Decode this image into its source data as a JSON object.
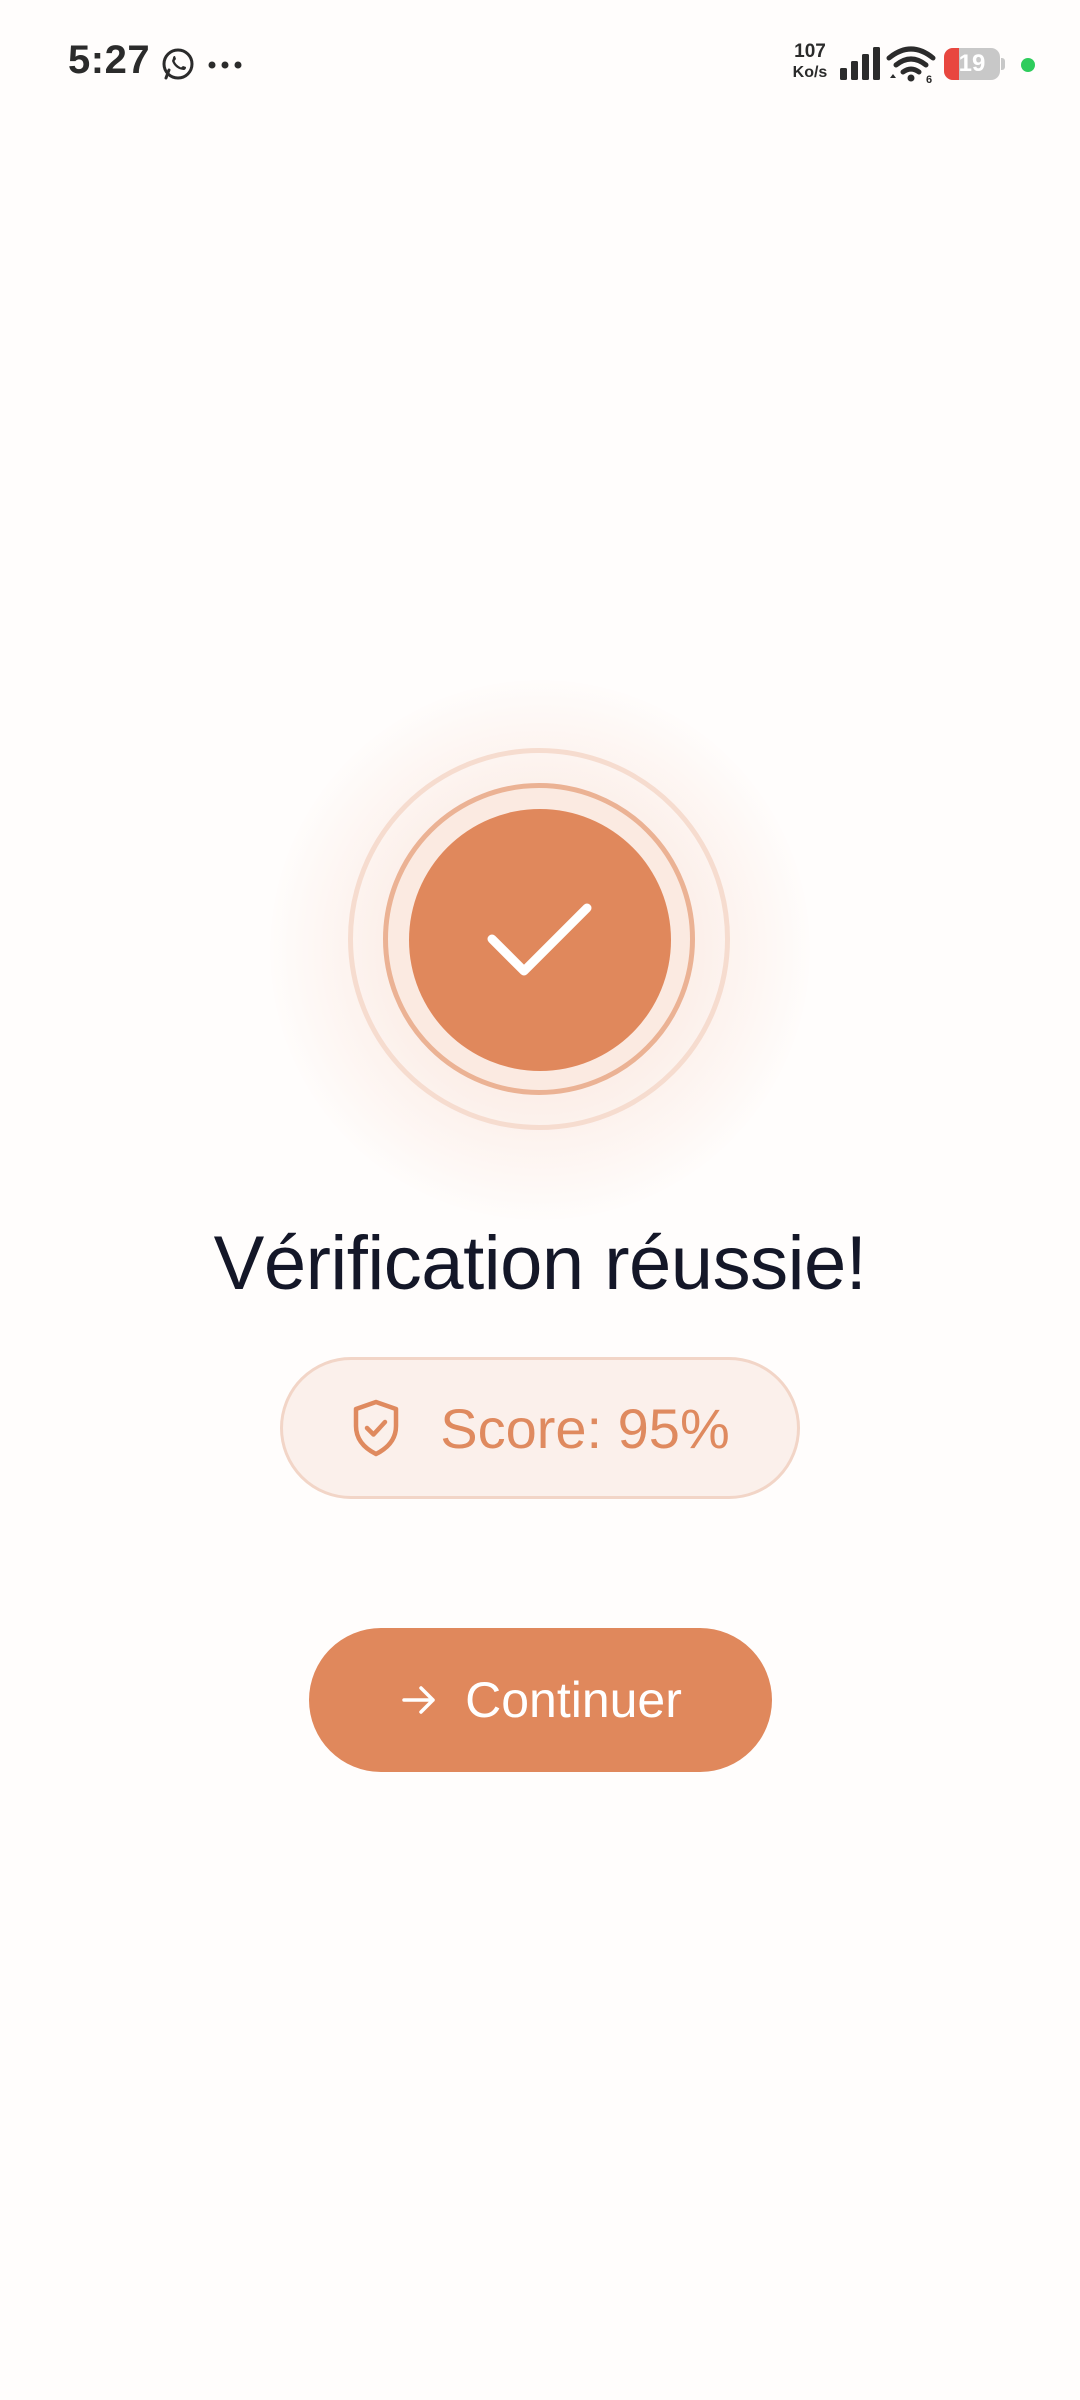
{
  "status_bar": {
    "time": "5:27",
    "net_speed_value": "107",
    "net_speed_unit": "Ko/s",
    "battery_level": "19",
    "battery_fraction": 0.19,
    "icons": [
      "whatsapp-icon",
      "more-icon",
      "signal-icon",
      "wifi-icon",
      "battery-icon",
      "green-dot"
    ],
    "colors": {
      "text": "#2b2b2b",
      "battery_low": "#e8473f",
      "active_dot": "#2ecc5c"
    }
  },
  "success": {
    "icon": "check-icon",
    "title": "Vérification réussie!",
    "score_icon": "shield-check-icon",
    "score_text": "Score: 95%",
    "score_value": 95
  },
  "actions": {
    "continue_icon": "arrow-right-icon",
    "continue_label": "Continuer"
  },
  "colors": {
    "accent": "#e0885c",
    "title": "#141728",
    "pill_background": "#fbf0eb",
    "background": "#fffdfc"
  }
}
